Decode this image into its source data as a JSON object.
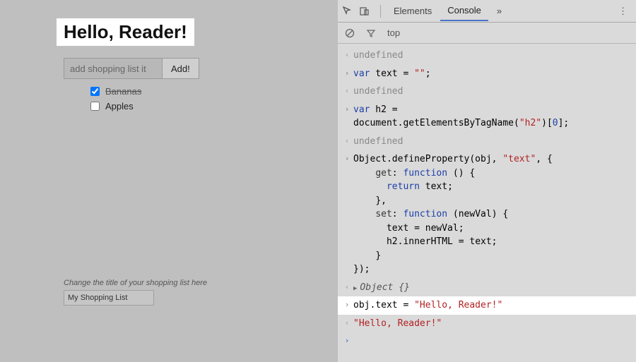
{
  "left": {
    "heading": "Hello, Reader!",
    "add_input_placeholder": "add shopping list it",
    "add_button_label": "Add!",
    "items": [
      {
        "label": "Bananas",
        "checked": true
      },
      {
        "label": "Apples",
        "checked": false
      }
    ],
    "title_hint": "Change the title of your shopping list here",
    "title_input_value": "My Shopping List"
  },
  "devtools": {
    "tabs": {
      "elements": "Elements",
      "console": "Console",
      "more": "»"
    },
    "toolbar": {
      "context": "top"
    },
    "console": [
      {
        "dir": "out",
        "type": "undef",
        "text": "undefined"
      },
      {
        "dir": "in",
        "type": "code",
        "html": "<span class='kw'>var</span> text = <span class='str'>\"\"</span>;"
      },
      {
        "dir": "out",
        "type": "undef",
        "text": "undefined"
      },
      {
        "dir": "in",
        "type": "code",
        "html": "<span class='kw'>var</span> h2 =\ndocument.getElementsByTagName(<span class='str'>\"h2\"</span>)[<span class='kw'>0</span>];"
      },
      {
        "dir": "out",
        "type": "undef",
        "text": "undefined"
      },
      {
        "dir": "in",
        "type": "code",
        "html": "Object.defineProperty(obj, <span class='str'>\"text\"</span>, {\n    <span class='key'>get</span>: <span class='kw'>function</span> () {\n      <span class='kw'>return</span> text;\n    },\n    <span class='key'>set</span>: <span class='kw'>function</span> (newVal) {\n      text = newVal;\n      h2.innerHTML = text;\n    }\n});"
      },
      {
        "dir": "out",
        "type": "obj",
        "text": "Object {}"
      },
      {
        "dir": "in",
        "type": "code",
        "highlight": true,
        "html": "obj.text = <span class='str'>\"Hello, Reader!\"</span>"
      },
      {
        "dir": "out",
        "type": "str",
        "text": "\"Hello, Reader!\""
      },
      {
        "dir": "in",
        "type": "prompt",
        "text": ""
      }
    ]
  }
}
